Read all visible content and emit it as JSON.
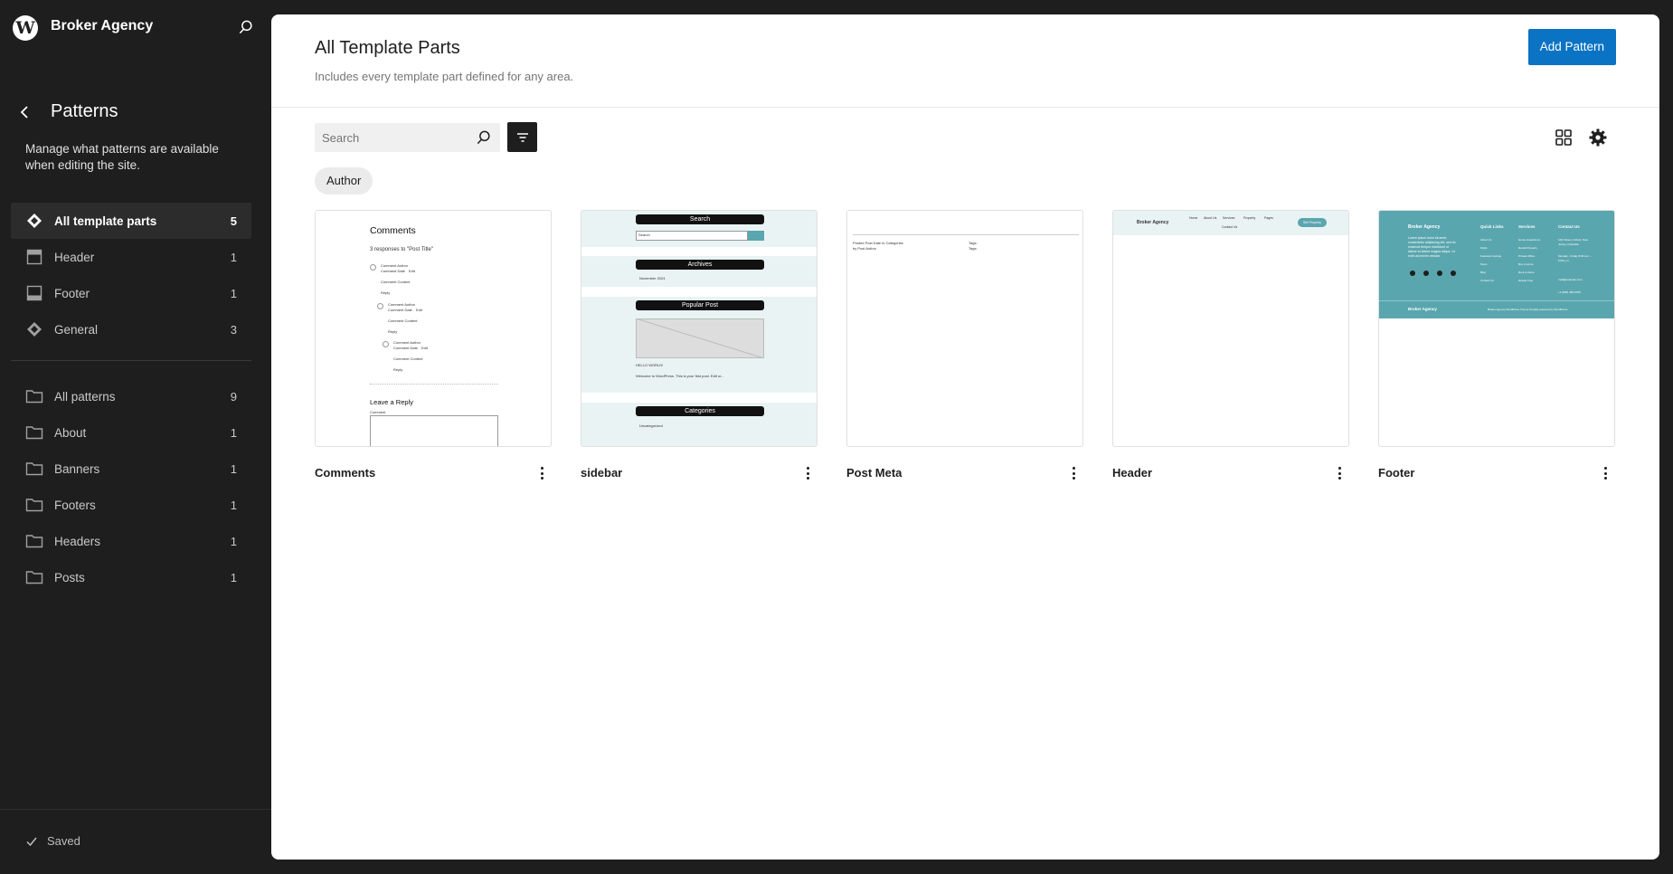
{
  "site": {
    "title": "Broker Agency"
  },
  "sidebar": {
    "title": "Patterns",
    "description": "Manage what patterns are available when editing the site.",
    "template_parts": [
      {
        "label": "All template parts",
        "count": "5",
        "icon": "diamond-icon"
      },
      {
        "label": "Header",
        "count": "1",
        "icon": "header-layout-icon"
      },
      {
        "label": "Footer",
        "count": "1",
        "icon": "footer-layout-icon"
      },
      {
        "label": "General",
        "count": "3",
        "icon": "diamond-icon"
      }
    ],
    "categories": [
      {
        "label": "All patterns",
        "count": "9",
        "icon": "folder-icon"
      },
      {
        "label": "About",
        "count": "1",
        "icon": "folder-icon"
      },
      {
        "label": "Banners",
        "count": "1",
        "icon": "folder-icon"
      },
      {
        "label": "Footers",
        "count": "1",
        "icon": "folder-icon"
      },
      {
        "label": "Headers",
        "count": "1",
        "icon": "folder-icon"
      },
      {
        "label": "Posts",
        "count": "1",
        "icon": "folder-icon"
      }
    ],
    "save_status": "Saved"
  },
  "main": {
    "title": "All Template Parts",
    "description": "Includes every template part defined for any area.",
    "add_button": "Add Pattern",
    "search_placeholder": "Search",
    "filter_chip": "Author"
  },
  "cards": [
    {
      "title": "Comments"
    },
    {
      "title": "sidebar"
    },
    {
      "title": "Post Meta"
    },
    {
      "title": "Header"
    },
    {
      "title": "Footer"
    }
  ],
  "previews": {
    "comments": {
      "heading": "Comments",
      "responses": "3 responses to \"Post Title\"",
      "author": "Comment Author",
      "date": "Comment Date",
      "edit": "Edit",
      "content": "Comment Content",
      "reply": "Reply",
      "leave_reply": "Leave a Reply",
      "comment_label": "Comment"
    },
    "sidebar": {
      "search": "Search",
      "search_field": "Search",
      "archives": "Archives",
      "archive_item": "November 2024",
      "popular": "Popular Post",
      "post_title": "HELLO WORLD!",
      "post_excerpt": "Welcome to WordPress. This is your first post. Edit or...",
      "categories": "Categories",
      "category_item": "Uncategorized"
    },
    "post_meta": {
      "posted": "Posted Post Date in Categories",
      "by": "by Post Author",
      "tags1": "Tags:",
      "tags2": "Tags:"
    },
    "header": {
      "brand": "Broker Agency",
      "nav": [
        "Home",
        "About Us",
        "Services",
        "Property",
        "Pages"
      ],
      "contact": "Contact Us",
      "cta": "Sell Property"
    },
    "footer": {
      "brand": "Broker Agency",
      "about": "Lorem ipsum dolor sit amet, consectetur adipiscing elit, sed do eiusmod tempor incididunt ut labore et dolore magna aliqua. Ut enim ad minim veniam.",
      "quick_links": "Quick Links",
      "services": "Services",
      "contact": "Contact Us",
      "links": [
        "About Us",
        "FAQs",
        "Featured Listings",
        "Team",
        "Blog",
        "Contact Us"
      ],
      "service_items": [
        "Home Inspections",
        "Rental Property",
        "Private Office",
        "Buy A Home",
        "Rent A Home",
        "Hassle Free"
      ],
      "address": "14th Street, Oxford, New Jersey, Finlandia",
      "hours": "Monday - Friday 8:00 a.m. - 5:00 p.m.",
      "email": "mail@example.com",
      "phone": "+1 (800) 456-6789",
      "bottom_brand": "Broker Agency",
      "credit": "Broker Agency WordPress Theme Proudly powered by WordPress",
      "teal": "#5aa6ae"
    }
  },
  "colors": {
    "accent": "#0a73c4",
    "sidebar_bg": "#1e1e1e",
    "teal": "#5aa6ae",
    "light_teal": "#e9f3f4"
  }
}
